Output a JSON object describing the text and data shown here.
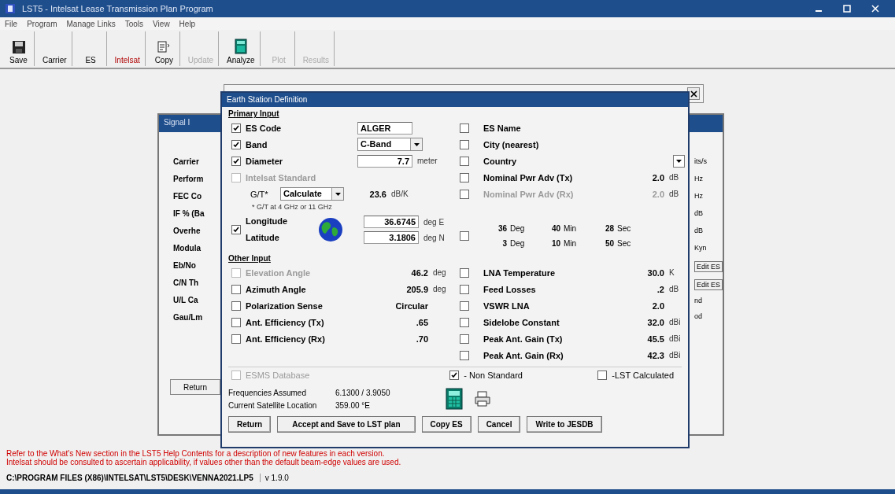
{
  "window": {
    "title": "LST5 - Intelsat Lease Transmission Plan Program"
  },
  "menu": [
    "File",
    "Program",
    "Manage Links",
    "Tools",
    "View",
    "Help"
  ],
  "toolbar": [
    {
      "label": "Save",
      "disabled": false,
      "highlighted": false
    },
    {
      "label": "Carrier",
      "disabled": false,
      "highlighted": false
    },
    {
      "label": "ES",
      "disabled": false,
      "highlighted": false
    },
    {
      "label": "Intelsat",
      "disabled": false,
      "highlighted": true
    },
    {
      "label": "Copy",
      "disabled": false,
      "highlighted": false
    },
    {
      "label": "Update",
      "disabled": true,
      "highlighted": false
    },
    {
      "label": "Analyze",
      "disabled": false,
      "highlighted": false
    },
    {
      "label": "Plot",
      "disabled": true,
      "highlighted": false
    },
    {
      "label": "Results",
      "disabled": true,
      "highlighted": false
    }
  ],
  "back_window": {
    "title": "Signal I",
    "labels": [
      "Carrier",
      "Perform",
      "FEC Co",
      "IF % (Ba",
      "Overhe",
      "Modula",
      "Eb/No",
      "C/N Th",
      "U/L Ca",
      "Gau/Lm"
    ],
    "units": [
      "its/s",
      "Hz",
      "Hz",
      "dB",
      "dB",
      "Kyn"
    ],
    "buttons": [
      "Edit ES",
      "Edit ES"
    ],
    "notes": [
      "nd",
      "od"
    ],
    "return_button": "Return"
  },
  "dialog": {
    "title": "Earth Station Definition",
    "primary_heading": "Primary Input",
    "primary_left": [
      {
        "kind": "field",
        "label": "ES Code",
        "checked": true,
        "disabled": false,
        "value": "ALGER"
      },
      {
        "kind": "combo",
        "label": "Band",
        "checked": true,
        "disabled": false,
        "value": "C-Band"
      },
      {
        "kind": "field",
        "label": "Diameter",
        "checked": true,
        "disabled": false,
        "value": "7.7",
        "unit": "meter"
      },
      {
        "kind": "check",
        "label": "Intelsat Standard",
        "checked": false,
        "disabled": true
      },
      {
        "kind": "gt",
        "label": "G/T*",
        "value": "Calculate",
        "reading": "23.6",
        "unit": "dB/K"
      },
      {
        "kind": "note",
        "text": "* G/T at 4 GHz or 11 GHz"
      }
    ],
    "location": {
      "checked": true,
      "rows": [
        {
          "label": "Longitude",
          "value": "36.6745",
          "unit": "deg E"
        },
        {
          "label": "Latitude",
          "value": "3.1806",
          "unit": "deg N"
        }
      ]
    },
    "primary_right": [
      {
        "kind": "check",
        "label": "ES Name",
        "checked": false,
        "disabled": false
      },
      {
        "kind": "check",
        "label": "City (nearest)",
        "checked": false,
        "disabled": false
      },
      {
        "kind": "combo",
        "label": "Country",
        "checked": false,
        "disabled": false
      },
      {
        "kind": "value",
        "label": "Nominal Pwr Adv (Tx)",
        "checked": false,
        "disabled": false,
        "value": "2.0",
        "unit": "dB"
      },
      {
        "kind": "value",
        "label": "Nominal Pwr Adv (Rx)",
        "checked": false,
        "disabled": true,
        "value": "2.0",
        "unit": "dB"
      }
    ],
    "dms": {
      "checked": false,
      "rows": [
        {
          "deg": "36",
          "deg_unit": "Deg",
          "min": "40",
          "min_unit": "Min",
          "sec": "28",
          "sec_unit": "Sec"
        },
        {
          "deg": "3",
          "deg_unit": "Deg",
          "min": "10",
          "min_unit": "Min",
          "sec": "50",
          "sec_unit": "Sec"
        }
      ]
    },
    "other_heading": "Other Input",
    "other_left": [
      {
        "label": "Elevation Angle",
        "checked": false,
        "disabled": true,
        "value": "46.2",
        "unit": "deg"
      },
      {
        "label": "Azimuth Angle",
        "checked": false,
        "disabled": false,
        "value": "205.9",
        "unit": "deg"
      },
      {
        "label": "Polarization Sense",
        "checked": false,
        "disabled": false,
        "value": "Circular"
      },
      {
        "label": "Ant. Efficiency (Tx)",
        "checked": false,
        "disabled": false,
        "value": ".65"
      },
      {
        "label": "Ant. Efficiency (Rx)",
        "checked": false,
        "disabled": false,
        "value": ".70"
      }
    ],
    "other_right": [
      {
        "label": "LNA Temperature",
        "checked": false,
        "disabled": false,
        "value": "30.0",
        "unit": "K"
      },
      {
        "label": "Feed Losses",
        "checked": false,
        "disabled": false,
        "value": ".2",
        "unit": "dB"
      },
      {
        "label": "VSWR LNA",
        "checked": false,
        "disabled": false,
        "value": "2.0"
      },
      {
        "label": "Sidelobe Constant",
        "checked": false,
        "disabled": false,
        "value": "32.0",
        "unit": "dBi"
      },
      {
        "label": "Peak Ant. Gain (Tx)",
        "checked": false,
        "disabled": false,
        "value": "45.5",
        "unit": "dBi"
      },
      {
        "label": "Peak Ant. Gain (Rx)",
        "checked": false,
        "disabled": false,
        "value": "42.3",
        "unit": "dBi"
      }
    ],
    "esms": {
      "label": "ESMS Database",
      "checked": false,
      "disabled": true
    },
    "standard": {
      "label": "- Non Standard",
      "checked": true
    },
    "lst_calculated": {
      "label": "-LST Calculated",
      "checked": false
    },
    "info": [
      {
        "label": "Frequencies Assumed",
        "value": "6.1300 / 3.9050"
      },
      {
        "label": "Current Satellite Location",
        "value": "359.00 °E"
      }
    ],
    "buttons": [
      "Return",
      "Accept and Save to LST plan",
      "Copy ES",
      "Cancel",
      "Write to JESDB"
    ]
  },
  "notes": [
    "Refer to the What's New section in the LST5 Help Contents for a description of new features in each version.",
    "Intelsat should be consulted to ascertain applicability, if values other than the default beam-edge values are used."
  ],
  "status_bar": {
    "path": "C:\\PROGRAM FILES (X86)\\INTELSAT\\LST5\\DESK\\VENNA2021.LP5",
    "version": "v 1.9.0"
  }
}
